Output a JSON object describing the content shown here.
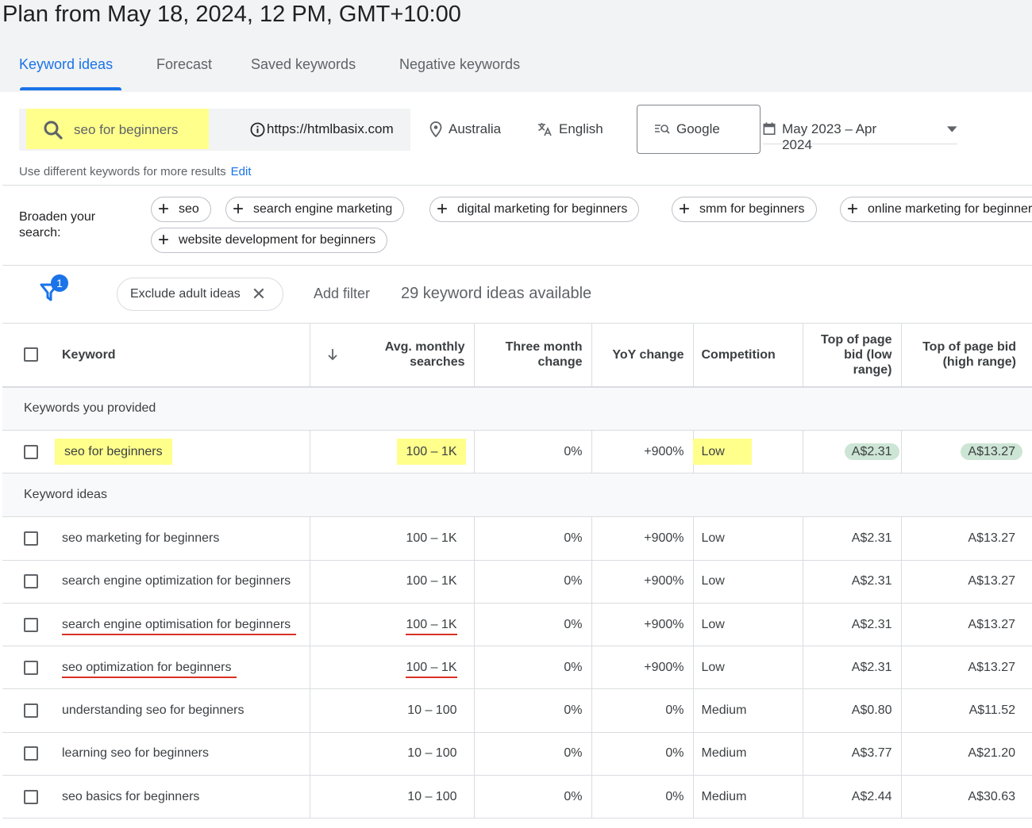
{
  "page_title": "Plan from May 18, 2024, 12 PM, GMT+10:00",
  "tabs": [
    {
      "label": "Keyword ideas",
      "active": true
    },
    {
      "label": "Forecast"
    },
    {
      "label": "Saved keywords"
    },
    {
      "label": "Negative keywords"
    }
  ],
  "search": {
    "keyword": "seo for beginners",
    "url": "https://htmlbasix.com",
    "location": "Australia",
    "language": "English",
    "network": "Google",
    "date_range": "May 2023 – Apr 2024"
  },
  "hint": {
    "text": "Use different keywords for more results",
    "edit": "Edit"
  },
  "broaden": {
    "label": "Broaden your search:",
    "chips": [
      "seo",
      "search engine marketing",
      "digital marketing for beginners",
      "smm for beginners",
      "online marketing for beginners",
      "website development for beginners"
    ]
  },
  "filters": {
    "badge": "1",
    "chip": "Exclude adult ideas",
    "add_filter": "Add filter",
    "count_text": "29 keyword ideas available"
  },
  "table": {
    "headers": {
      "keyword": "Keyword",
      "avg": "Avg. monthly searches",
      "three_month": "Three month change",
      "yoy": "YoY change",
      "competition": "Competition",
      "bid_low": "Top of page bid (low range)",
      "bid_high": "Top of page bid (high range)"
    },
    "section_provided": "Keywords you provided",
    "section_ideas": "Keyword ideas",
    "provided": [
      {
        "keyword": "seo for beginners",
        "avg": "100 – 1K",
        "three_month": "0%",
        "yoy": "+900%",
        "competition": "Low",
        "bid_low": "A$2.31",
        "bid_high": "A$13.27"
      }
    ],
    "ideas": [
      {
        "keyword": "seo marketing for beginners",
        "avg": "100 – 1K",
        "three_month": "0%",
        "yoy": "+900%",
        "competition": "Low",
        "bid_low": "A$2.31",
        "bid_high": "A$13.27"
      },
      {
        "keyword": "search engine optimization for beginners",
        "avg": "100 – 1K",
        "three_month": "0%",
        "yoy": "+900%",
        "competition": "Low",
        "bid_low": "A$2.31",
        "bid_high": "A$13.27"
      },
      {
        "keyword": "search engine optimisation for beginners",
        "avg": "100 – 1K",
        "three_month": "0%",
        "yoy": "+900%",
        "competition": "Low",
        "bid_low": "A$2.31",
        "bid_high": "A$13.27"
      },
      {
        "keyword": "seo optimization for beginners",
        "avg": "100 – 1K",
        "three_month": "0%",
        "yoy": "+900%",
        "competition": "Low",
        "bid_low": "A$2.31",
        "bid_high": "A$13.27"
      },
      {
        "keyword": "understanding seo for beginners",
        "avg": "10 – 100",
        "three_month": "0%",
        "yoy": "0%",
        "competition": "Medium",
        "bid_low": "A$0.80",
        "bid_high": "A$11.52"
      },
      {
        "keyword": "learning seo for beginners",
        "avg": "10 – 100",
        "three_month": "0%",
        "yoy": "0%",
        "competition": "Medium",
        "bid_low": "A$3.77",
        "bid_high": "A$21.20"
      },
      {
        "keyword": "seo basics for beginners",
        "avg": "10 – 100",
        "three_month": "0%",
        "yoy": "0%",
        "competition": "Medium",
        "bid_low": "A$2.44",
        "bid_high": "A$30.63"
      }
    ]
  },
  "colors": {
    "accent": "#1a73e8",
    "highlight": "#ffff8c",
    "bid_pill": "#cde5d4",
    "underline": "#d93025"
  }
}
